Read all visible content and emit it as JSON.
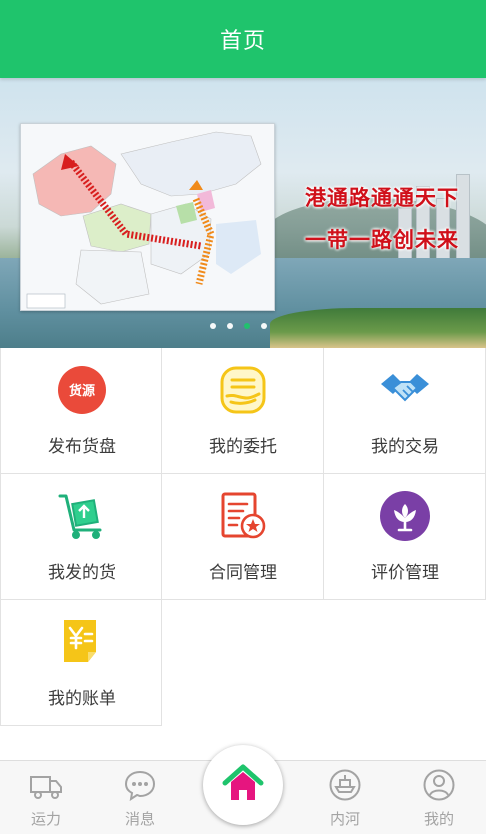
{
  "header": {
    "title": "首页"
  },
  "banner": {
    "slogan_line1": "港通路通通天下",
    "slogan_line2": "一带一路创未来",
    "dots": [
      false,
      false,
      true,
      false
    ]
  },
  "menu": [
    {
      "label": "发布货盘",
      "icon": "cargo-source-icon",
      "badge_text": "货源"
    },
    {
      "label": "我的委托",
      "icon": "entrust-hand-icon"
    },
    {
      "label": "我的交易",
      "icon": "handshake-icon"
    },
    {
      "label": "我发的货",
      "icon": "hand-truck-icon"
    },
    {
      "label": "合同管理",
      "icon": "contract-icon"
    },
    {
      "label": "评价管理",
      "icon": "rating-flower-icon"
    },
    {
      "label": "我的账单",
      "icon": "bill-icon"
    }
  ],
  "tabbar": {
    "items": [
      {
        "label": "运力",
        "icon": "truck-icon"
      },
      {
        "label": "消息",
        "icon": "message-icon"
      },
      {
        "label": "内河",
        "icon": "ship-icon"
      },
      {
        "label": "我的",
        "icon": "user-icon"
      }
    ],
    "center_icon": "home-icon"
  },
  "colors": {
    "brand_green": "#1fc46c",
    "slogan_red": "#d0101a",
    "badge_red": "#ea4a3a",
    "yellow": "#f5c518",
    "blue": "#3a8fd8",
    "purple": "#7a3fa6",
    "home_pink": "#e6157f"
  }
}
